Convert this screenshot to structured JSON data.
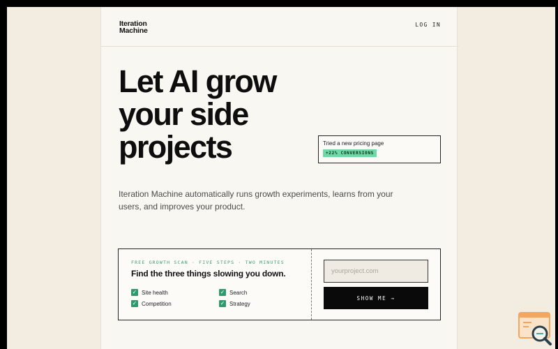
{
  "brand": {
    "line1": "Iteration",
    "line2": "Machine"
  },
  "header": {
    "login_label": "LOG IN"
  },
  "hero": {
    "headline": "Let AI grow your side projects",
    "subhead": "Iteration Machine automatically runs growth experiments, learns from your users, and improves your product."
  },
  "experiment_card": {
    "text": "Tried a new pricing page",
    "badge": "+22% CONVERSIONS",
    "badge_color": "#6fd9a6"
  },
  "scan": {
    "eyebrow": "FREE GROWTH SCAN · FIVE STEPS · TWO MINUTES",
    "title": "Find the three things slowing you down.",
    "checks": [
      "Site health",
      "Search",
      "Competition",
      "Strategy"
    ],
    "input_placeholder": "yourproject.com",
    "input_value": "",
    "submit_label": "SHOW ME →"
  },
  "colors": {
    "accent_green": "#2e9b6e",
    "eyebrow_green": "#3d9b78",
    "background": "#f3ede1",
    "column": "#f9f7f1",
    "button": "#0a0a0a",
    "widget_orange": "#f2a65f"
  },
  "icons": {
    "check": "checkmark-icon",
    "widget": "search-widget-icon"
  }
}
